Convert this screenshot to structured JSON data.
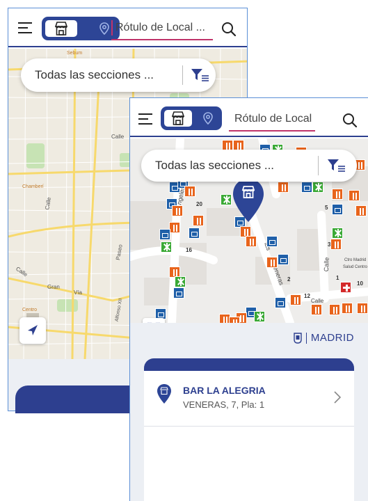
{
  "back_screen": {
    "search_placeholder": "Rótulo de Local ...",
    "sections_label": "Todas las secciones ...",
    "map_labels": {
      "street_top": "Sebum",
      "calle": "Calle",
      "chamberi": "Chamberí",
      "calle_left": "Calle",
      "paseo": "Paseo",
      "calle_bottom": "Calle",
      "gran": "Gran",
      "via": "Vía",
      "centro": "Centro",
      "alfonso": "Alfonso XII"
    }
  },
  "front_screen": {
    "search_placeholder": "Rótulo de Local ...",
    "sections_label": "Todas las secciones ...",
    "brand": "MADRID",
    "map_labels": {
      "angeles": "Ángeles",
      "las": "las",
      "veneras": "Veneras",
      "calle": "Calle",
      "calle_right": "Calle",
      "n20": "20",
      "n16": "16",
      "n5": "5",
      "n3": "3",
      "n10": "10",
      "n12": "12",
      "n2": "2",
      "n1": "1",
      "ctro_madrid": "Ctro Madrid",
      "salud": "Salud Centro"
    },
    "result": {
      "name": "BAR LA ALEGRIA",
      "address": "VENERAS, 7, Pla: 1"
    }
  },
  "colors": {
    "navy": "#2d3f8f",
    "toggle": "#2d4596",
    "caret": "#c0336a",
    "orange_marker": "#e8641c",
    "blue_marker": "#1f5fa8",
    "green_marker": "#3aa935",
    "red_marker": "#d42a2a"
  }
}
